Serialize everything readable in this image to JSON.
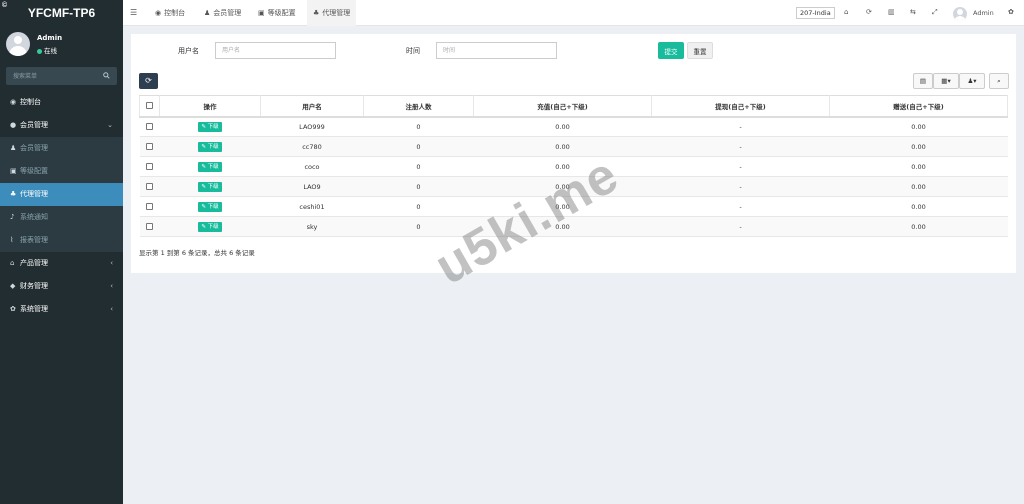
{
  "sidebar": {
    "logo": "YFCMF-TP6",
    "corner_glyph": "©",
    "user": {
      "name": "Admin",
      "status": "在线"
    },
    "search": {
      "placeholder": "搜索菜单"
    },
    "menu": [
      {
        "label": "控制台",
        "icon": "dashboard-icon",
        "glyph": "◉"
      },
      {
        "label": "会员管理",
        "icon": "users-icon",
        "glyph": "●",
        "chev": "⌄"
      },
      {
        "label": "会员管理",
        "icon": "user-icon",
        "glyph": "♟"
      },
      {
        "label": "等级配置",
        "icon": "level-icon",
        "glyph": "▣"
      },
      {
        "label": "代理管理",
        "icon": "sitemap-icon",
        "glyph": "♣",
        "active": true
      },
      {
        "label": "系统通知",
        "icon": "bell-icon",
        "glyph": "♪"
      },
      {
        "label": "报表管理",
        "icon": "chart-icon",
        "glyph": "⌇"
      },
      {
        "label": "产品管理",
        "icon": "home-icon",
        "glyph": "⌂",
        "chev": "‹"
      },
      {
        "label": "财务管理",
        "icon": "finance-icon",
        "glyph": "◆",
        "chev": "‹"
      },
      {
        "label": "系统管理",
        "icon": "gears-icon",
        "glyph": "✿",
        "chev": "‹"
      }
    ]
  },
  "topbar": {
    "tabs": [
      {
        "label": "控制台",
        "glyph": "◉"
      },
      {
        "label": "会员管理",
        "glyph": "♟"
      },
      {
        "label": "等级配置",
        "glyph": "▣"
      },
      {
        "label": "代理管理",
        "glyph": "♣"
      }
    ],
    "region_badge": "207-India",
    "admin_label": "Admin"
  },
  "form": {
    "username_label": "用户名",
    "username_placeholder": "用户名",
    "time_label": "时间",
    "time_placeholder": "时间",
    "submit_label": "提交",
    "reset_label": "重置"
  },
  "table": {
    "headers": [
      "操作",
      "用户名",
      "注册人数",
      "充值(自己+下级)",
      "提现(自己+下级)",
      "赠送(自己+下级)"
    ],
    "action_label": "下级",
    "rows": [
      {
        "username": "LAO999",
        "registered": "0",
        "recharge": "0.00",
        "withdraw": "-",
        "gift": "0.00"
      },
      {
        "username": "cc780",
        "registered": "0",
        "recharge": "0.00",
        "withdraw": "-",
        "gift": "0.00"
      },
      {
        "username": "coco",
        "registered": "0",
        "recharge": "0.00",
        "withdraw": "-",
        "gift": "0.00"
      },
      {
        "username": "LAO9",
        "registered": "0",
        "recharge": "0.00",
        "withdraw": "-",
        "gift": "0.00"
      },
      {
        "username": "ceshi01",
        "registered": "0",
        "recharge": "0.00",
        "withdraw": "-",
        "gift": "0.00"
      },
      {
        "username": "sky",
        "registered": "0",
        "recharge": "0.00",
        "withdraw": "-",
        "gift": "0.00"
      }
    ],
    "pagination_text": "显示第 1 到第 6 条记录，总共 6 条记录"
  },
  "watermark": "u5ki.me"
}
